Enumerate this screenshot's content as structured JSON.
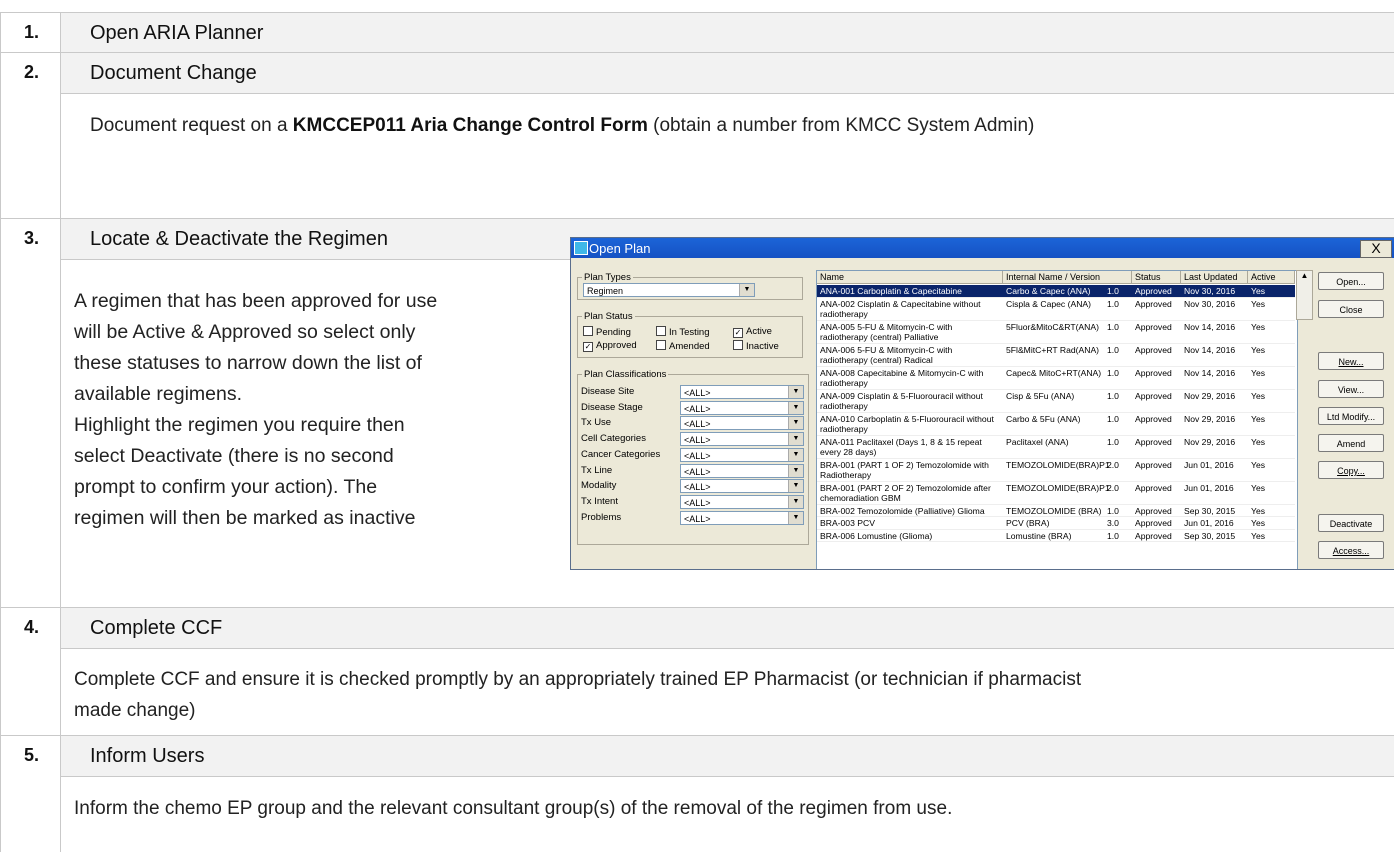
{
  "steps": [
    {
      "num": "1.",
      "title": "Open ARIA Planner"
    },
    {
      "num": "2.",
      "title": "Document Change",
      "text_pre": "Document request on a ",
      "text_bold": "KMCCEP011 Aria Change Control Form",
      "text_post": " (obtain a number from KMCC System Admin)"
    },
    {
      "num": "3.",
      "title": "Locate & Deactivate the Regimen",
      "lines": [
        "A regimen that has been approved for use",
        "will be Active & Approved so select only",
        "these statuses to narrow down the list of",
        "available regimens.",
        "Highlight the regimen you require then",
        "select Deactivate (there is no second",
        "prompt to confirm your action). The",
        "regimen will then be marked as inactive"
      ]
    },
    {
      "num": "4.",
      "title": "Complete CCF",
      "lines": [
        "Complete CCF and ensure it is checked promptly by an appropriately trained EP Pharmacist (or technician if pharmacist",
        "made change)"
      ]
    },
    {
      "num": "5.",
      "title": "Inform Users",
      "text": "Inform the chemo EP group and the relevant consultant group(s) of the removal of the regimen from use."
    }
  ],
  "dialog": {
    "title": "Open Plan",
    "close": "X",
    "plan_types_legend": "Plan Types",
    "plan_types_value": "Regimen",
    "plan_status_legend": "Plan Status",
    "statuses": [
      {
        "label": "Pending",
        "checked": false
      },
      {
        "label": "In Testing",
        "checked": false
      },
      {
        "label": "Active",
        "checked": true
      },
      {
        "label": "Approved",
        "checked": true
      },
      {
        "label": "Amended",
        "checked": false
      },
      {
        "label": "Inactive",
        "checked": false
      }
    ],
    "classifications_legend": "Plan Classifications",
    "classifications": [
      {
        "label": "Disease Site",
        "value": "<ALL>"
      },
      {
        "label": "Disease Stage",
        "value": "<ALL>"
      },
      {
        "label": "Tx Use",
        "value": "<ALL>"
      },
      {
        "label": "Cell Categories",
        "value": "<ALL>"
      },
      {
        "label": "Cancer Categories",
        "value": "<ALL>"
      },
      {
        "label": "Tx Line",
        "value": "<ALL>"
      },
      {
        "label": "Modality",
        "value": "<ALL>"
      },
      {
        "label": "Tx Intent",
        "value": "<ALL>"
      },
      {
        "label": "Problems",
        "value": "<ALL>"
      }
    ],
    "columns": [
      "Name",
      "Internal Name / Version",
      "Status",
      "Last Updated",
      "Active"
    ],
    "rows": [
      {
        "name": [
          "ANA-001 Carboplatin & Capecitabine"
        ],
        "internal": "Carbo & Capec (ANA)",
        "ver": "1.0",
        "status": "Approved",
        "date": "Nov 30, 2016",
        "active": "Yes"
      },
      {
        "name": [
          "ANA-002 Cisplatin & Capecitabine without",
          "radiotherapy"
        ],
        "internal": "Cispla & Capec (ANA)",
        "ver": "1.0",
        "status": "Approved",
        "date": "Nov 30, 2016",
        "active": "Yes"
      },
      {
        "name": [
          "ANA-005 5-FU & Mitomycin-C with",
          "radiotherapy (central) Palliative"
        ],
        "internal": "5Fluor&MitoC&RT(ANA)",
        "ver": "1.0",
        "status": "Approved",
        "date": "Nov 14, 2016",
        "active": "Yes"
      },
      {
        "name": [
          "ANA-006 5-FU & Mitomycin-C with",
          "radiotherapy (central) Radical"
        ],
        "internal": "5Fl&MitC+RT Rad(ANA)",
        "ver": "1.0",
        "status": "Approved",
        "date": "Nov 14, 2016",
        "active": "Yes"
      },
      {
        "name": [
          "ANA-008 Capecitabine & Mitomycin-C with",
          "radiotherapy"
        ],
        "internal": "Capec& MitoC+RT(ANA)",
        "ver": "1.0",
        "status": "Approved",
        "date": "Nov 14, 2016",
        "active": "Yes"
      },
      {
        "name": [
          "ANA-009 Cisplatin & 5-Fluorouracil without",
          "radiotherapy"
        ],
        "internal": "Cisp & 5Fu (ANA)",
        "ver": "1.0",
        "status": "Approved",
        "date": "Nov 29, 2016",
        "active": "Yes"
      },
      {
        "name": [
          "ANA-010 Carboplatin & 5-Fluorouracil without",
          "radiotherapy"
        ],
        "internal": "Carbo & 5Fu (ANA)",
        "ver": "1.0",
        "status": "Approved",
        "date": "Nov 29, 2016",
        "active": "Yes"
      },
      {
        "name": [
          "ANA-011 Paclitaxel (Days 1, 8 & 15 repeat",
          "every 28 days)"
        ],
        "internal": "Paclitaxel (ANA)",
        "ver": "1.0",
        "status": "Approved",
        "date": "Nov 29, 2016",
        "active": "Yes"
      },
      {
        "name": [
          "BRA-001 (PART 1 OF 2) Temozolomide with",
          "Radiotherapy"
        ],
        "internal": "TEMOZOLOMIDE(BRA)P1",
        "ver": "2.0",
        "status": "Approved",
        "date": "Jun 01, 2016",
        "active": "Yes"
      },
      {
        "name": [
          "BRA-001 (PART 2 OF 2) Temozolomide after",
          "chemoradiation GBM"
        ],
        "internal": "TEMOZOLOMIDE(BRA)P1",
        "ver": "2.0",
        "status": "Approved",
        "date": "Jun 01, 2016",
        "active": "Yes"
      },
      {
        "name": [
          "BRA-002 Temozolomide (Palliative) Glioma"
        ],
        "internal": "TEMOZOLOMIDE (BRA)",
        "ver": "1.0",
        "status": "Approved",
        "date": "Sep 30, 2015",
        "active": "Yes"
      },
      {
        "name": [
          "BRA-003 PCV"
        ],
        "internal": "PCV (BRA)",
        "ver": "3.0",
        "status": "Approved",
        "date": "Jun 01, 2016",
        "active": "Yes"
      },
      {
        "name": [
          "BRA-006 Lomustine (Glioma)"
        ],
        "internal": "Lomustine (BRA)",
        "ver": "1.0",
        "status": "Approved",
        "date": "Sep 30, 2015",
        "active": "Yes"
      }
    ],
    "buttons": [
      "Open...",
      "Close",
      "New...",
      "View...",
      "Ltd Modify...",
      "Amend",
      "Copy...",
      "Deactivate",
      "Access..."
    ]
  }
}
